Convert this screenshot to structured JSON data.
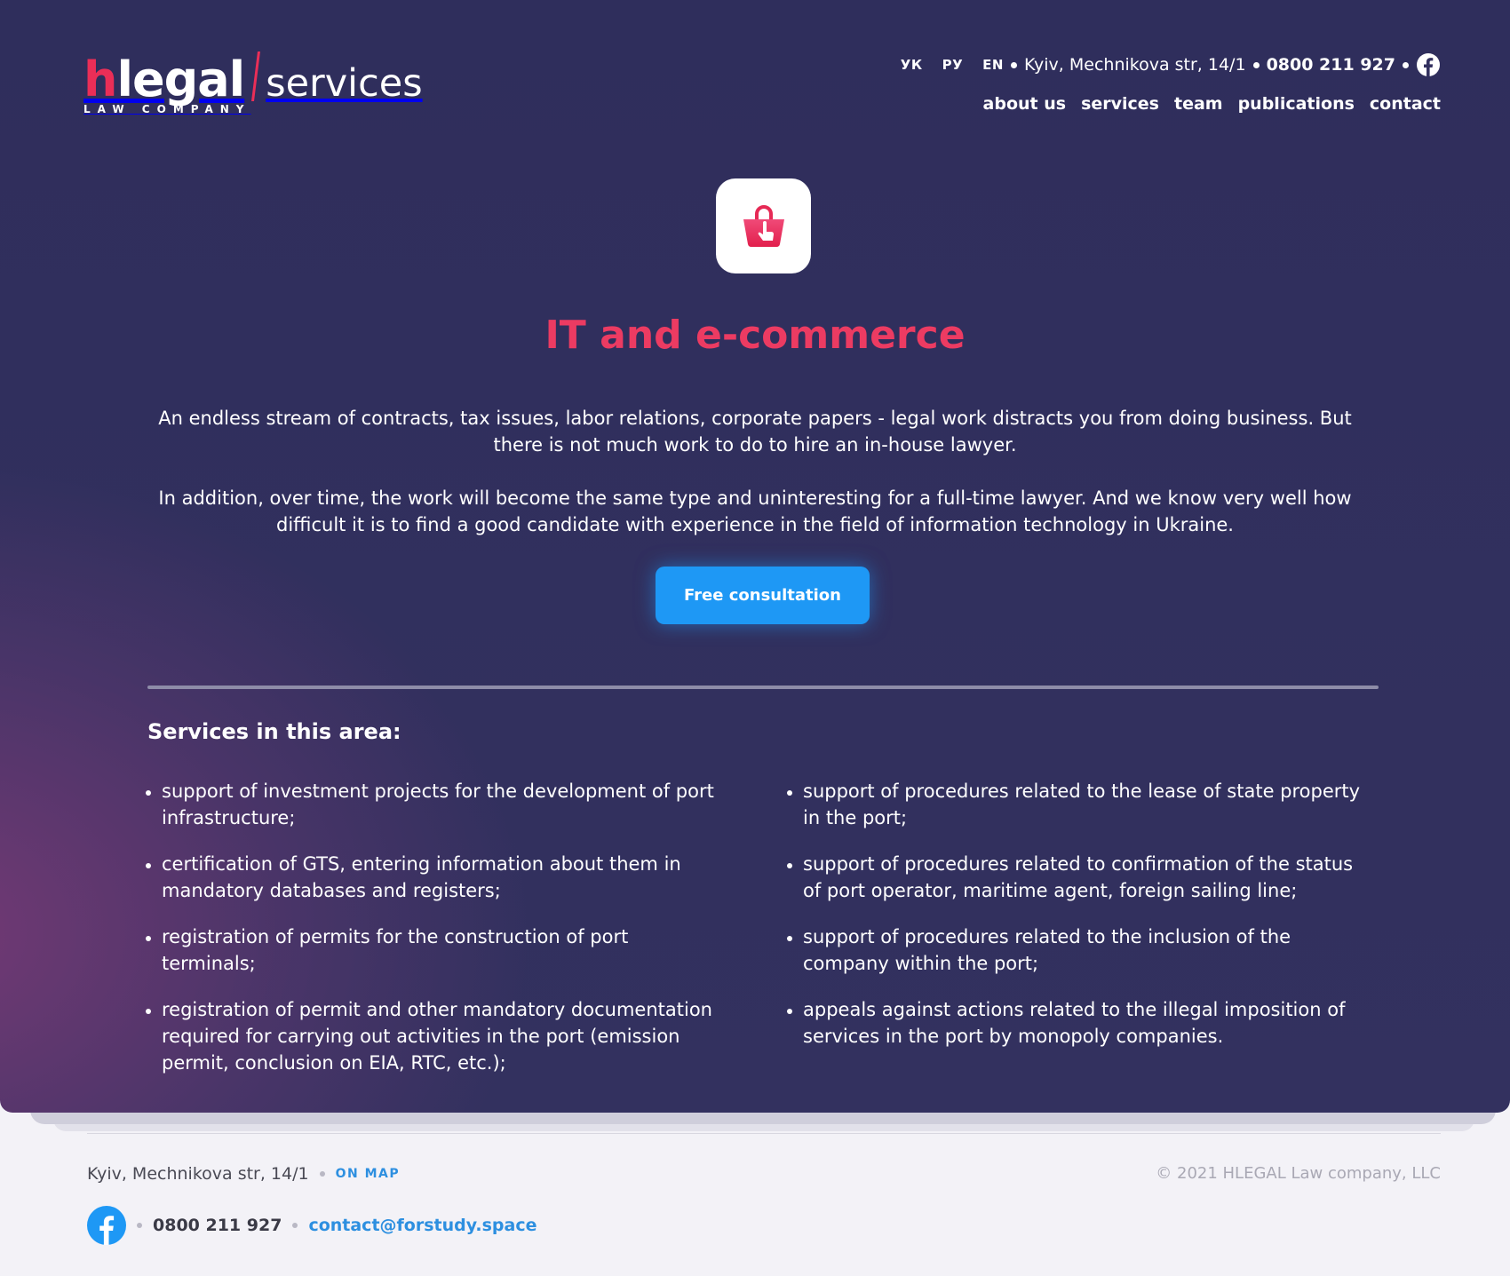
{
  "brand": {
    "logo_h": "h",
    "logo_legal": "legal",
    "logo_services": "services",
    "logo_subtitle": "LAW COMPANY"
  },
  "topbar": {
    "languages": [
      "УК",
      "РУ",
      "EN"
    ],
    "address": "Kyiv, Mechnikova str, 14/1",
    "phone": "0800 211 927",
    "social_icon": "facebook-icon"
  },
  "nav": {
    "items": [
      "about us",
      "services",
      "team",
      "publications",
      "contact"
    ]
  },
  "hero": {
    "icon": "shopping-bag-cursor-icon",
    "title": "IT and e-commerce",
    "paragraph1": "An endless stream of contracts, tax issues, labor relations, corporate papers - legal work distracts you from doing business. But there is not much work to do to hire an in-house lawyer.",
    "paragraph2": "In addition, over time, the work will become the same type and uninteresting for a full-time lawyer. And we know very well how difficult it is to find a good candidate with experience in the field of information technology in Ukraine.",
    "cta_label": "Free consultation"
  },
  "services": {
    "heading": "Services in this area:",
    "left": [
      "support of investment projects for the development of port infrastructure;",
      "certification of GTS, entering information about them in mandatory databases and registers;",
      "registration of permits for the construction of port terminals;",
      "registration of permit and other mandatory documentation required for carrying out activities in the port (emission permit, conclusion on EIA, RTC, etc.);"
    ],
    "right": [
      "support of procedures related to the lease of state property in the port;",
      "support of procedures related to confirmation of the status of port operator, maritime agent, foreign sailing line;",
      "support of procedures related to the inclusion of the company within the port;",
      "appeals against actions related to the illegal imposition of services in the port by monopoly companies."
    ]
  },
  "footer": {
    "address": "Kyiv, Mechnikova str, 14/1",
    "map_link": "ON MAP",
    "copyright": "© 2021 HLEGAL Law company, LLC",
    "phone": "0800 211 927",
    "email": "contact@forstudy.space",
    "social_icon": "facebook-icon"
  },
  "colors": {
    "accent_red": "#ea2e57",
    "cta_blue": "#1e98f5",
    "hero_bg": "#2f2e5c",
    "link_blue": "#2d8fe0"
  }
}
